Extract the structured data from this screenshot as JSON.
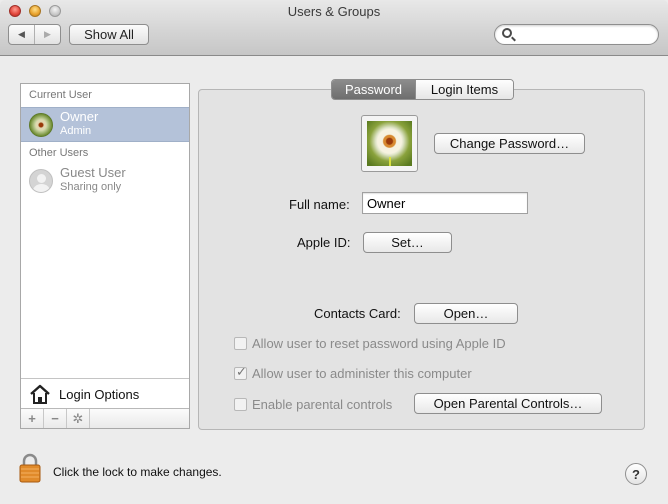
{
  "window": {
    "title": "Users & Groups"
  },
  "toolbar": {
    "back_icon": "◀",
    "forward_icon": "▶",
    "show_all_label": "Show All",
    "search_placeholder": "",
    "search_value": ""
  },
  "sidebar": {
    "current_user_header": "Current User",
    "other_users_header": "Other Users",
    "users": [
      {
        "name": "Owner",
        "role": "Admin",
        "selected": true
      },
      {
        "name": "Guest User",
        "role": "Sharing only",
        "selected": false
      }
    ],
    "login_options_label": "Login Options",
    "add_label": "+",
    "remove_label": "−",
    "action_label": "✲"
  },
  "tabs": [
    {
      "label": "Password",
      "active": true
    },
    {
      "label": "Login Items",
      "active": false
    }
  ],
  "password_pane": {
    "change_password_label": "Change Password…",
    "full_name_label": "Full name:",
    "full_name_value": "Owner",
    "apple_id_label": "Apple ID:",
    "apple_id_button": "Set…",
    "contacts_card_label": "Contacts Card:",
    "contacts_card_button": "Open…",
    "options": [
      {
        "label": "Allow user to reset password using Apple ID",
        "checked": false,
        "enabled": false
      },
      {
        "label": "Allow user to administer this computer",
        "checked": true,
        "enabled": false
      },
      {
        "label": "Enable parental controls",
        "checked": false,
        "enabled": false
      }
    ],
    "open_parental_controls_label": "Open Parental Controls…"
  },
  "footer": {
    "lock_text": "Click the lock to make changes.",
    "help_label": "?"
  }
}
